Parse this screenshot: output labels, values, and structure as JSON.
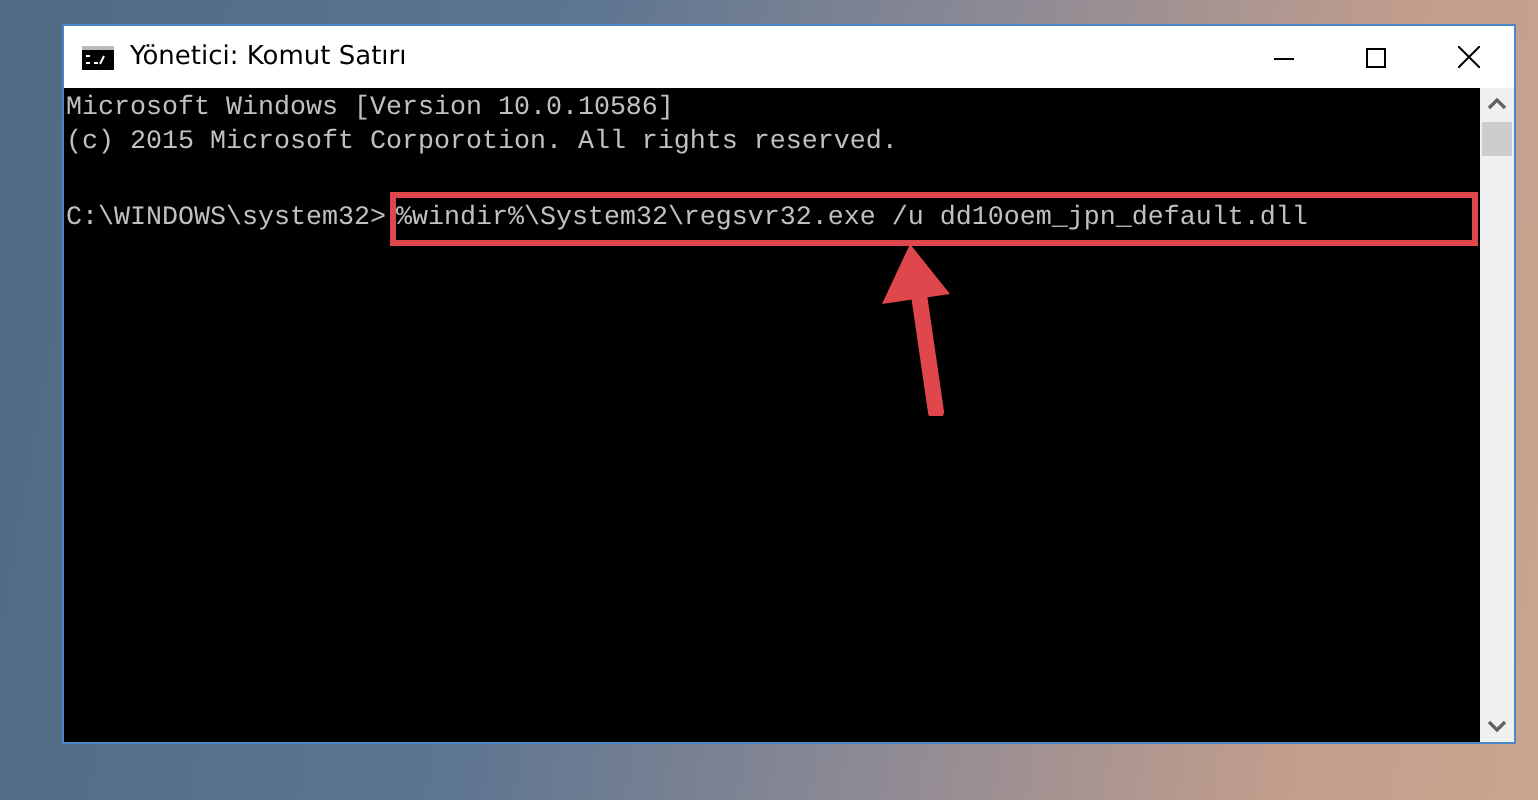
{
  "window": {
    "title": "Yönetici: Komut Satırı"
  },
  "console": {
    "lines": [
      "Microsoft Windows [Version 10.0.10586]",
      "(c) 2015 Microsoft Corporotion. All rights reserved."
    ],
    "prompt": "C:\\WINDOWS\\system32>",
    "command": "%windir%\\System32\\regsvr32.exe /u dd10oem_jpn_default.dll"
  }
}
